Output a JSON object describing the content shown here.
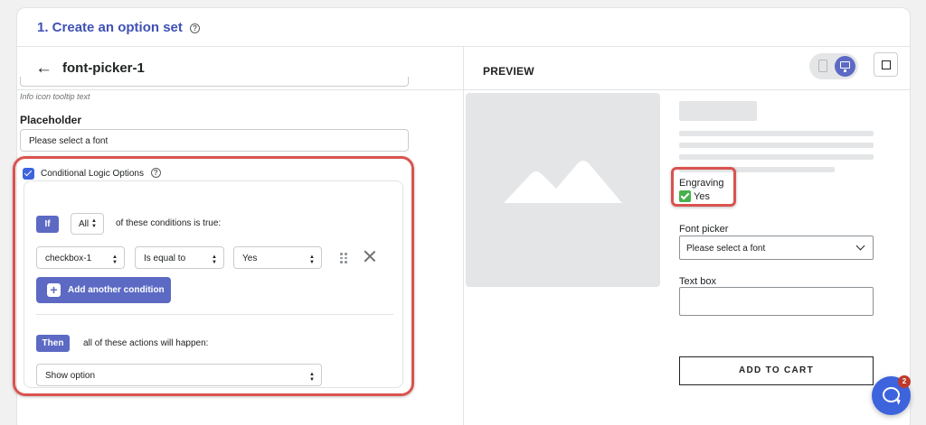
{
  "card": {
    "title": "1. Create an option set"
  },
  "editor": {
    "back_label": "←",
    "title": "font-picker-1",
    "helper_text": "Info icon tooltip text",
    "placeholder_label": "Placeholder",
    "placeholder_value": "Please select a font",
    "conditional_checked": true,
    "conditional_label": "Conditional Logic Options",
    "logic": {
      "if_tag": "If",
      "match_select": "All",
      "conditions_text": "of these conditions is true:",
      "condition": {
        "field": "checkbox-1",
        "operator": "Is equal to",
        "value": "Yes"
      },
      "add_condition_label": "Add another condition",
      "then_tag": "Then",
      "actions_text": "all of these actions will happen:",
      "action": "Show option"
    }
  },
  "preview": {
    "header": "PREVIEW",
    "engraving_label": "Engraving",
    "engraving_option": "Yes",
    "engraving_checked": true,
    "font_picker_label": "Font picker",
    "font_picker_placeholder": "Please select a font",
    "text_box_label": "Text box",
    "add_to_cart": "ADD TO CART"
  },
  "chat": {
    "badge_count": "2"
  },
  "colors": {
    "accent": "#5c6ac4",
    "title": "#3f51b5",
    "highlight": "#d9534f",
    "check_green": "#47b04b"
  },
  "icons": [
    "help-icon",
    "back-arrow-icon",
    "mobile-icon",
    "desktop-icon",
    "fullscreen-icon",
    "checkbox-icon",
    "drag-handle-icon",
    "close-icon",
    "plus-icon",
    "image-placeholder-icon",
    "chevron-down-icon",
    "chat-icon"
  ]
}
